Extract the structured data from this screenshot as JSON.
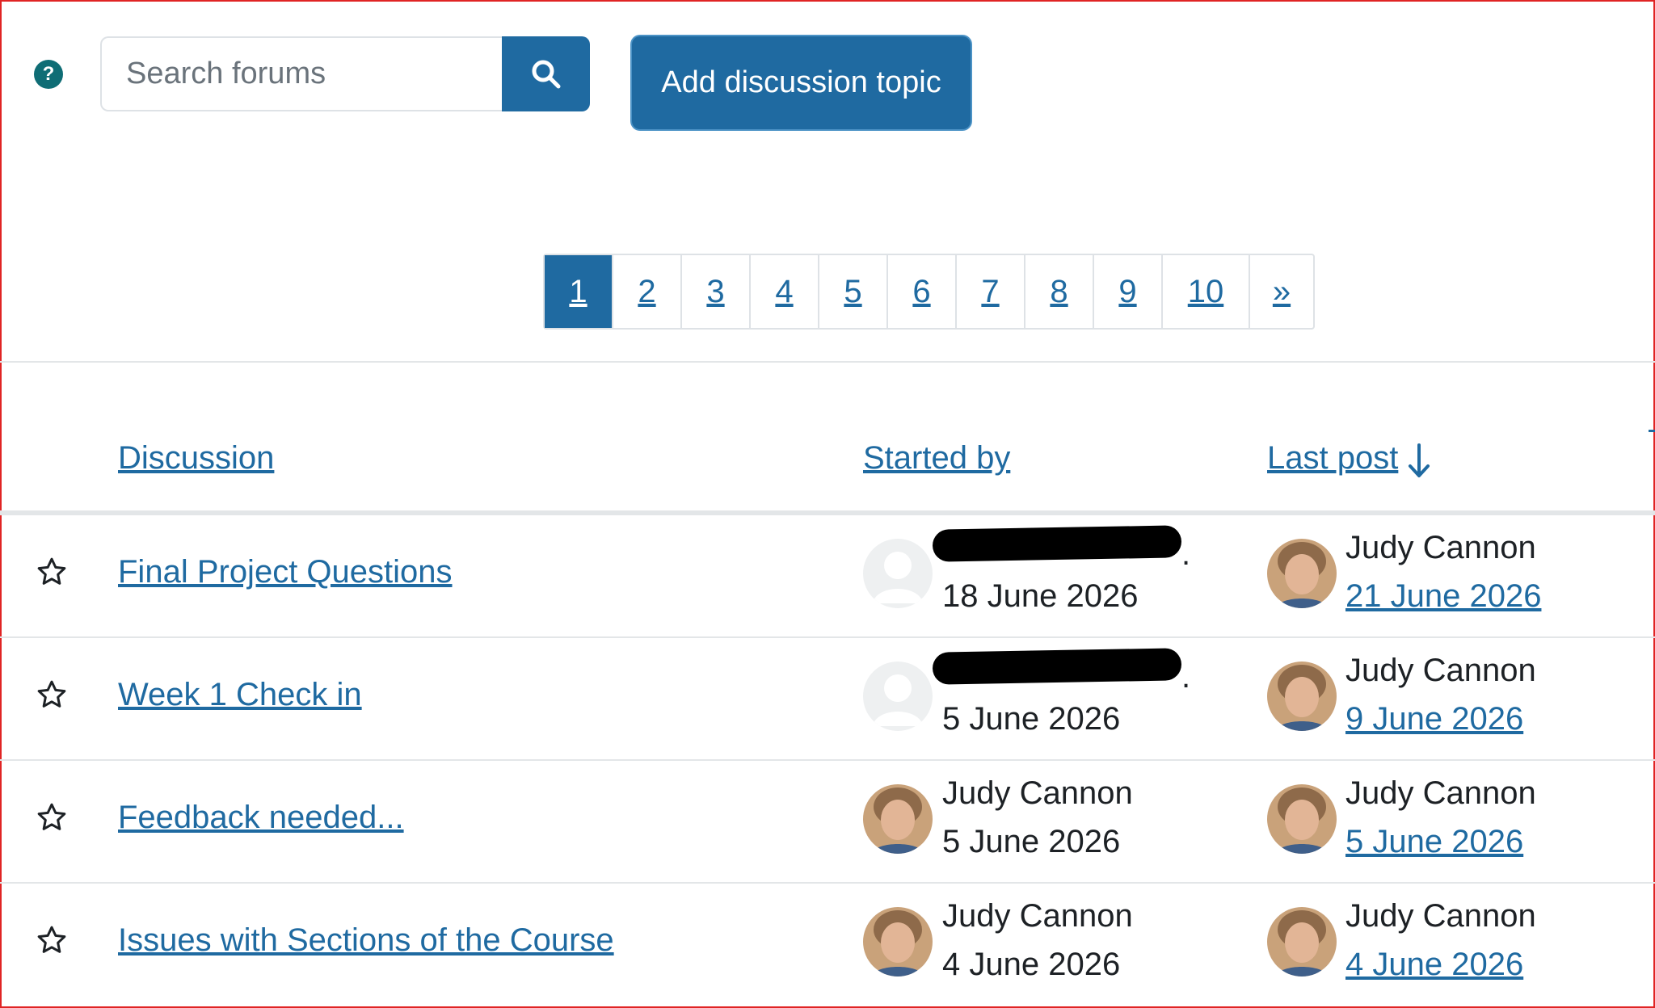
{
  "search": {
    "placeholder": "Search forums"
  },
  "actions": {
    "add_topic": "Add discussion topic"
  },
  "help": {
    "icon": "question-circle-icon",
    "glyph": "?"
  },
  "pagination": {
    "pages": [
      "1",
      "2",
      "3",
      "4",
      "5",
      "6",
      "7",
      "8",
      "9",
      "10",
      "»"
    ],
    "current": "1"
  },
  "table": {
    "headers": {
      "discussion": "Discussion",
      "started_by": "Started by",
      "last_post": "Last post"
    },
    "sort": {
      "column": "last_post",
      "direction": "descending"
    },
    "rows": [
      {
        "topic": "Final Project Questions",
        "starter": "",
        "started": "18 June 2026",
        "starter_avatar": "default",
        "last_author": "Judy Cannon",
        "last_date": "21 June 2026"
      },
      {
        "topic": "Week 1 Check in",
        "starter": "",
        "started": "5 June 2026",
        "starter_avatar": "default",
        "last_author": "Judy Cannon",
        "last_date": "9 June 2026"
      },
      {
        "topic": "Feedback needed...",
        "starter": "Judy Cannon",
        "started": "5 June 2026",
        "starter_avatar": "photo",
        "last_author": "Judy Cannon",
        "last_date": "5 June 2026"
      },
      {
        "topic": "Issues with Sections of the Course",
        "starter": "Judy Cannon",
        "started": "4 June 2026",
        "starter_avatar": "photo",
        "last_author": "Judy Cannon",
        "last_date": "4 June 2026"
      }
    ]
  },
  "colors": {
    "primary": "#1f6aa1",
    "help": "#0f6d75",
    "frame": "#e02424"
  }
}
